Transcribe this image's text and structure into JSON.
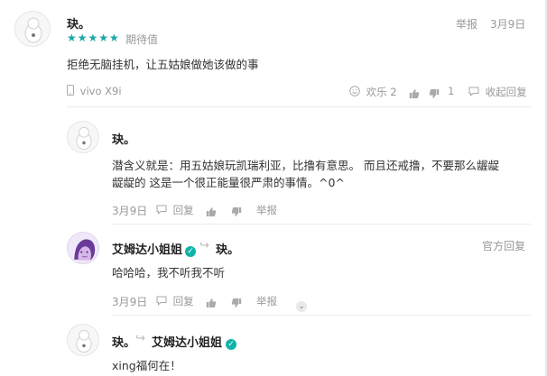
{
  "review": {
    "author": "玦。",
    "rating_label": "期待值",
    "stars": "★★★★★",
    "report": "举报",
    "date": "3月9日",
    "content": "拒绝无脑挂机，让五姑娘做她该做的事",
    "device": "vivo X9i",
    "huanle": "欢乐 2",
    "likes": "1",
    "collapse": "收起回复"
  },
  "replies": [
    {
      "author": "玦。",
      "content_line1": "潜含义就是：用五姑娘玩凯瑞利亚，比撸有意思。 而且还戒撸，不要那么龌龊",
      "content_line2": "龊龊的 这是一个很正能量很严肃的事情。^0^",
      "date": "3月9日",
      "reply": "回复",
      "report": "举报"
    },
    {
      "author": "艾姆达小姐姐",
      "arrow": "↪",
      "target": "玦。",
      "official": "官方回复",
      "content": "哈哈哈，我不听我不听",
      "date": "3月9日",
      "reply": "回复",
      "report": "举报"
    },
    {
      "author": "玦。",
      "arrow": "↪",
      "target": "艾姆达小姐姐",
      "content": "xing福何在！"
    }
  ],
  "icons": {
    "phone": "phone-icon",
    "smile": "smile-icon",
    "thumb_up": "thumb-up-icon",
    "thumb_down": "thumb-down-icon",
    "reply": "reply-icon",
    "verify": "verified-icon",
    "chevron": "chevron-down-icon"
  },
  "colors": {
    "accent": "#1aa6a6",
    "verified": "#11b3a8"
  }
}
